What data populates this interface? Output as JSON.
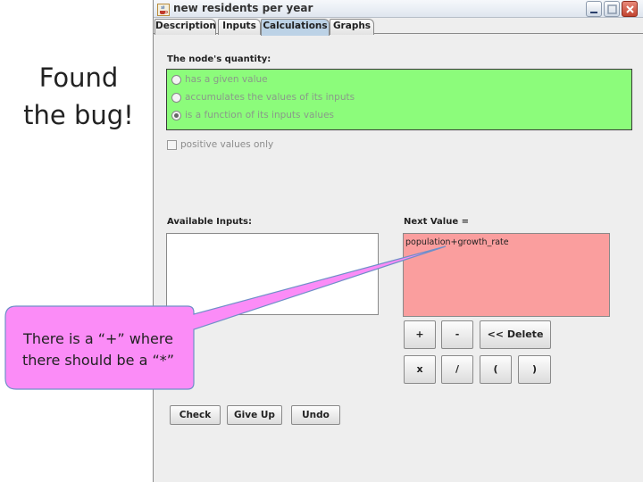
{
  "slide": {
    "annotation_lines": [
      "Found",
      "the bug!"
    ],
    "callout_lines": [
      "There is a “+” where",
      "there should be a “*”"
    ]
  },
  "window": {
    "title": "new residents per year",
    "app_icon": "java-coffee-icon",
    "controls": [
      "minimize-icon",
      "maximize-icon",
      "close-icon"
    ]
  },
  "tabs": [
    {
      "label": "Description",
      "active": false
    },
    {
      "label": "Inputs",
      "active": false
    },
    {
      "label": "Calculations",
      "active": true
    },
    {
      "label": "Graphs",
      "active": false
    }
  ],
  "quantity": {
    "label": "The node's quantity:",
    "options": [
      {
        "label": "has a given value",
        "selected": false
      },
      {
        "label": "accumulates the values of its inputs",
        "selected": false
      },
      {
        "label": "is a function of its inputs values",
        "selected": true
      }
    ],
    "box_color": "#8cfc7b"
  },
  "positive_only": {
    "label": "positive values only",
    "checked": false
  },
  "available_inputs": {
    "label": "Available Inputs:"
  },
  "next_value": {
    "label": "Next Value =",
    "expression": "population+growth_rate",
    "box_color": "#fa9e9e"
  },
  "calculator": {
    "plus": "+",
    "minus": "-",
    "delete": "<< Delete",
    "times": "x",
    "divide": "/",
    "open_paren": "(",
    "close_paren": ")"
  },
  "actions": {
    "check": "Check",
    "give_up": "Give Up",
    "undo": "Undo"
  },
  "colors": {
    "callout_fill": "#fb8cf7",
    "active_tab": "#bcd2e6"
  }
}
